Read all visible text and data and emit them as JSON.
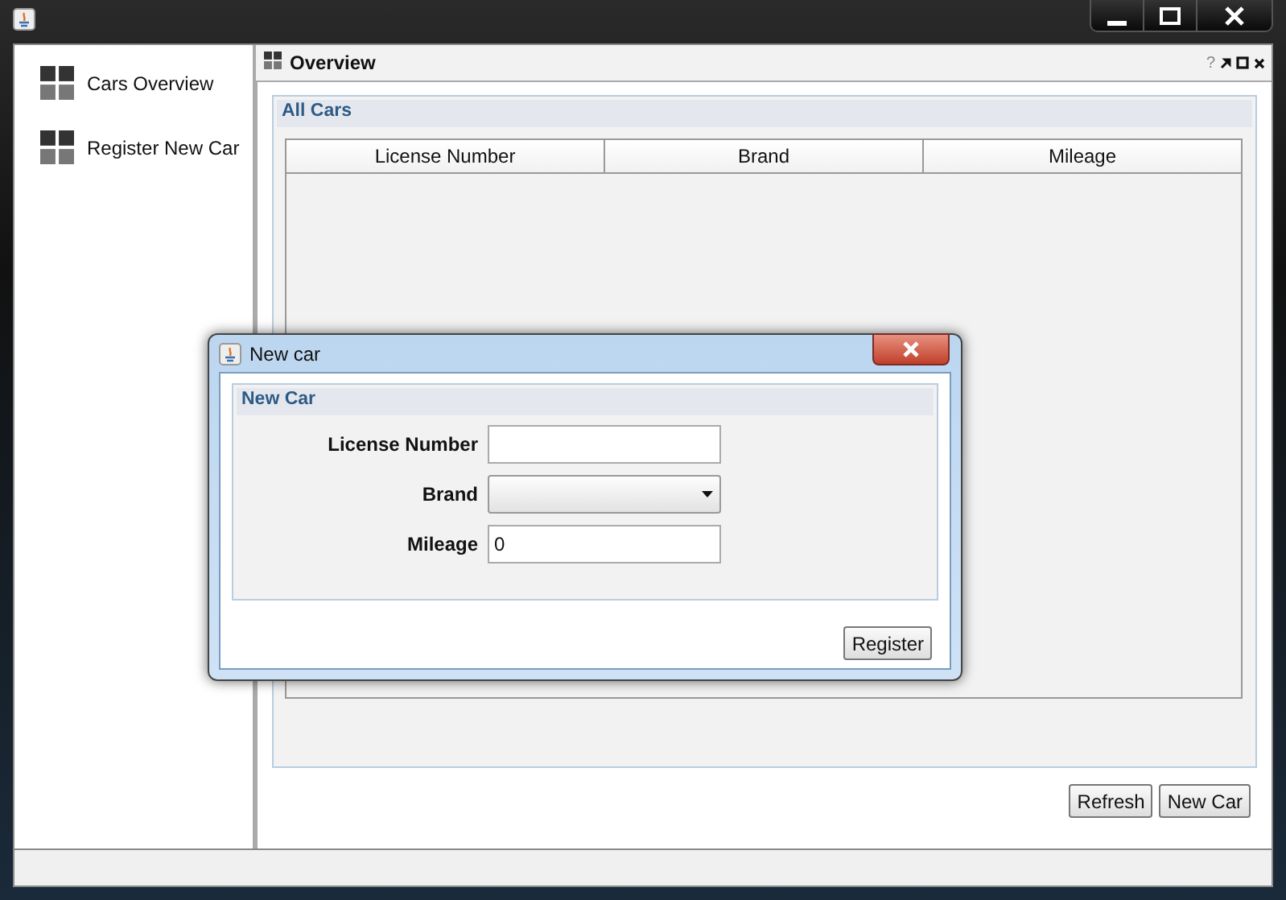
{
  "sidebar": {
    "items": [
      {
        "label": "Cars Overview"
      },
      {
        "label": "Register New Car"
      }
    ]
  },
  "panel": {
    "title": "Overview",
    "help": "?",
    "group": {
      "title": "All Cars",
      "table": {
        "columns": [
          "License Number",
          "Brand",
          "Mileage"
        ]
      }
    },
    "buttons": [
      "Refresh",
      "New Car"
    ]
  },
  "dialog": {
    "title": "New car",
    "group_title": "New Car",
    "fields": [
      {
        "kind": "text",
        "label": "License Number"
      },
      {
        "kind": "dropdown",
        "label": "Brand"
      },
      {
        "kind": "text",
        "label": "Mileage",
        "value": "0"
      }
    ],
    "buttons": [
      "Register"
    ]
  }
}
